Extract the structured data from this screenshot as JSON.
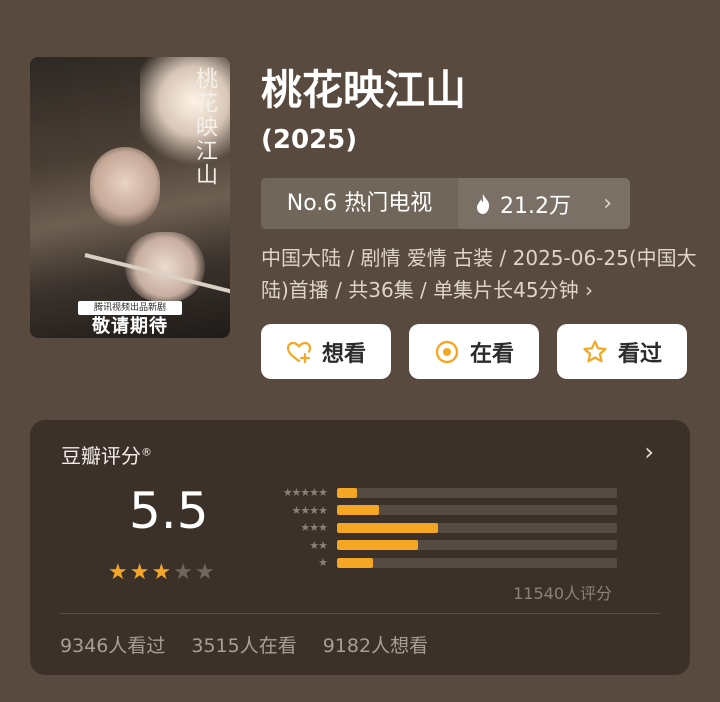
{
  "poster": {
    "calligraphy_title": "桃花映江山",
    "tag": "腾讯视频出品新剧",
    "banner": "敬请期待"
  },
  "title": "桃花映江山",
  "year": "(2025)",
  "rank": {
    "rank_text": "No.6 热门电视",
    "heat": "21.2万"
  },
  "meta": "中国大陆 / 剧情 爱情 古装 / 2025-06-25(中国大陆)首播 / 共36集 / 单集片长45分钟 ›",
  "buttons": {
    "want": "想看",
    "watching": "在看",
    "watched": "看过"
  },
  "rating": {
    "header": "豆瓣评分",
    "registered_mark": "®",
    "score": "5.5",
    "stars_filled": 3,
    "stars_total": 5,
    "count": "11540人评分",
    "distribution": [
      {
        "stars": "★★★★★",
        "fraction": 0.07
      },
      {
        "stars": "★★★★",
        "fraction": 0.15
      },
      {
        "stars": "★★★",
        "fraction": 0.36
      },
      {
        "stars": "★★",
        "fraction": 0.29
      },
      {
        "stars": "★",
        "fraction": 0.13
      }
    ]
  },
  "stats": {
    "watched": "9346人看过",
    "watching": "3515人在看",
    "want": "9182人想看"
  },
  "colors": {
    "background": "#584a3e",
    "card": "#3b3129",
    "accent": "#f5a623"
  }
}
